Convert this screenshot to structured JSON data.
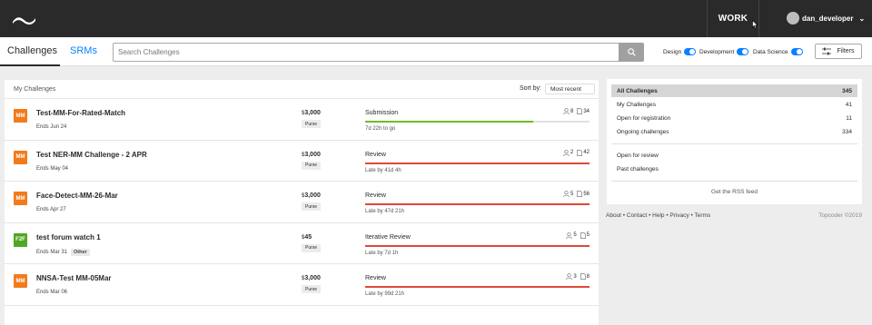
{
  "header": {
    "work_label": "WORK",
    "username": "dan_developer"
  },
  "nav": {
    "tabs": [
      "Challenges",
      "SRMs"
    ]
  },
  "search": {
    "placeholder": "Search Challenges"
  },
  "toggles": [
    {
      "label": "Design",
      "on": true
    },
    {
      "label": "Development",
      "on": true
    },
    {
      "label": "Data Science",
      "on": true
    }
  ],
  "filters_label": "Filters",
  "list": {
    "title": "My Challenges",
    "sort_label": "Sort by:",
    "sort_value": "Most recent",
    "rows": [
      {
        "track": "MM",
        "name": "Test-MM-For-Rated-Match",
        "ends": "Ends Jun 24",
        "tag": "",
        "currency": "$",
        "prize": "3,000",
        "purse": "Purse",
        "phase": "Submission",
        "progress": 0.75,
        "bar_color": "#6dbb2b",
        "time": "7d 22h to go",
        "registrants": "8",
        "submissions": "34"
      },
      {
        "track": "MM",
        "name": "Test NER-MM Challenge - 2 APR",
        "ends": "Ends May 04",
        "tag": "",
        "currency": "$",
        "prize": "3,000",
        "purse": "Purse",
        "phase": "Review",
        "progress": 1.0,
        "bar_color": "#e0473a",
        "time": "Late by 41d 4h",
        "registrants": "2",
        "submissions": "42"
      },
      {
        "track": "MM",
        "name": "Face-Detect-MM-26-Mar",
        "ends": "Ends Apr 27",
        "tag": "",
        "currency": "$",
        "prize": "3,000",
        "purse": "Purse",
        "phase": "Review",
        "progress": 1.0,
        "bar_color": "#e0473a",
        "time": "Late by 47d 21h",
        "registrants": "5",
        "submissions": "56"
      },
      {
        "track": "F2F",
        "name": "test forum watch 1",
        "ends": "Ends Mar 31",
        "tag": "Other",
        "currency": "$",
        "prize": "45",
        "purse": "Purse",
        "phase": "Iterative Review",
        "progress": 1.0,
        "bar_color": "#e0473a",
        "time": "Late by 7d 1h",
        "registrants": "5",
        "submissions": "5"
      },
      {
        "track": "MM",
        "name": "NNSA-Test MM-05Mar",
        "ends": "Ends Mar 06",
        "tag": "",
        "currency": "$",
        "prize": "3,000",
        "purse": "Purse",
        "phase": "Review",
        "progress": 1.0,
        "bar_color": "#e0473a",
        "time": "Late by 99d 21h",
        "registrants": "3",
        "submissions": "8"
      }
    ]
  },
  "sidebar": {
    "items": [
      {
        "label": "All Challenges",
        "count": "345",
        "active": true
      },
      {
        "label": "My Challenges",
        "count": "41"
      },
      {
        "label": "Open for registration",
        "count": "11"
      },
      {
        "label": "Ongoing challenges",
        "count": "334"
      },
      {
        "label": "Open for review",
        "count": ""
      },
      {
        "label": "Past challenges",
        "count": ""
      }
    ],
    "rss": "Get the RSS feed"
  },
  "footer": {
    "links": "About • Contact • Help • Privacy • Terms",
    "copyright": "Topcoder ©2019"
  }
}
